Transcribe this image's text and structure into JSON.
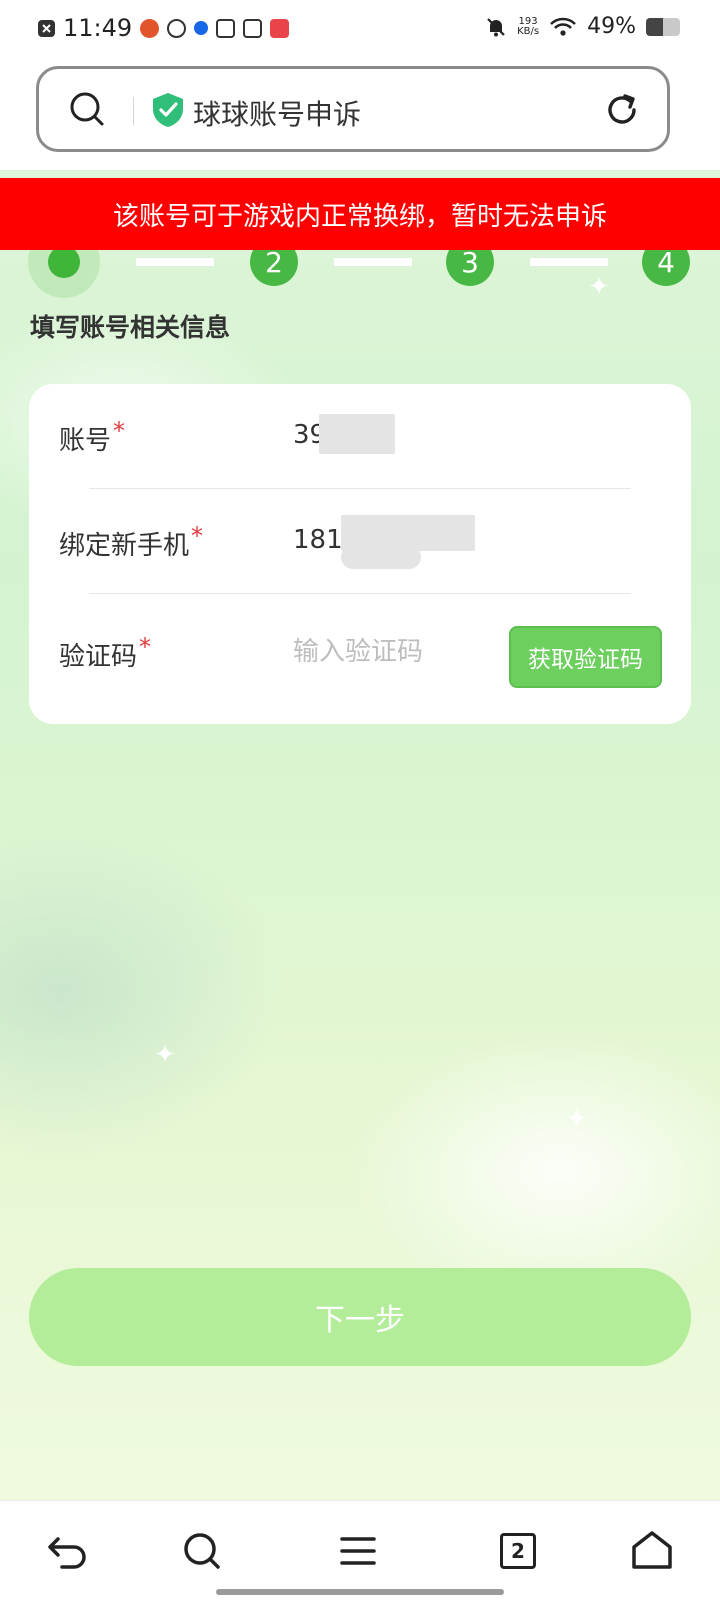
{
  "status_bar": {
    "time": "11:49",
    "net_speed_value": "193",
    "net_speed_unit": "KB/s",
    "battery_percent": "49%",
    "battery_level": 0.49
  },
  "address_bar": {
    "title": "球球账号申诉",
    "icons": [
      "search-icon",
      "shield-check-icon",
      "refresh-icon"
    ]
  },
  "banner": {
    "text": "该账号可于游戏内正常换绑，暂时无法申诉",
    "color": "#ff0000"
  },
  "steps": {
    "current": 1,
    "items": [
      "1",
      "2",
      "3",
      "4"
    ]
  },
  "section": {
    "title": "填写账号相关信息"
  },
  "form": {
    "account": {
      "label": "账号",
      "required_mark": "*",
      "value": "39"
    },
    "phone": {
      "label": "绑定新手机",
      "required_mark": "*",
      "value": "1817"
    },
    "code": {
      "label": "验证码",
      "required_mark": "*",
      "value": "",
      "placeholder": "输入验证码",
      "button_label": "获取验证码"
    }
  },
  "next_button": {
    "label": "下一步"
  },
  "bottom_nav": {
    "tab_count": "2",
    "icons": [
      "back-icon",
      "search-icon",
      "menu-icon",
      "tabs-icon",
      "home-icon"
    ]
  },
  "colors": {
    "accent_green": "#47b844",
    "button_green": "#6ccf5e",
    "next_button_disabled": "#b3ed9a",
    "required_red": "#e4393c"
  }
}
